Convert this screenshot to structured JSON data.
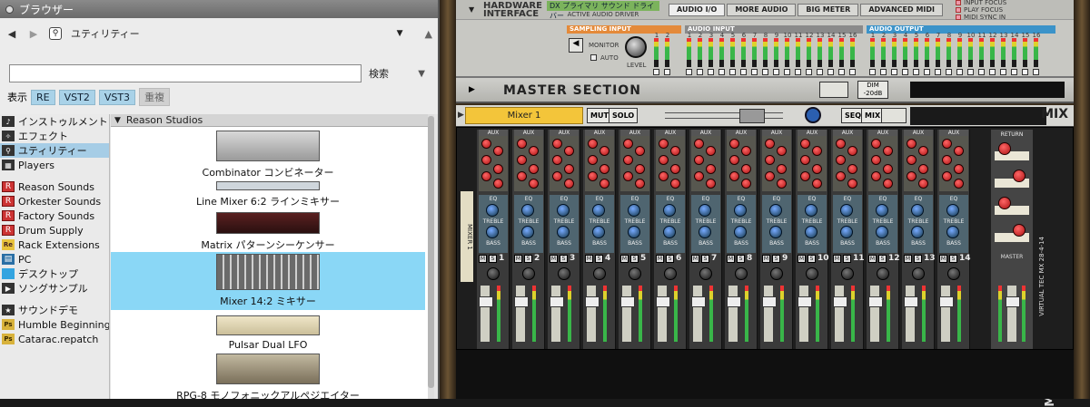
{
  "browser": {
    "title": "ブラウザー",
    "location_label": "ユティリティー",
    "search_placeholder": "",
    "search_button": "検索",
    "filter_label": "表示",
    "filters": [
      {
        "label": "RE",
        "on": true
      },
      {
        "label": "VST2",
        "on": true
      },
      {
        "label": "VST3",
        "on": true
      },
      {
        "label": "重複",
        "on": false
      }
    ],
    "left_items": [
      {
        "label": "インストゥルメント",
        "icon": "instrument-icon",
        "sel": false
      },
      {
        "label": "エフェクト",
        "icon": "effect-icon",
        "sel": false
      },
      {
        "label": "ユティリティー",
        "icon": "utility-icon",
        "sel": true
      },
      {
        "label": "Players",
        "icon": "players-icon",
        "sel": false
      },
      {
        "sep": true
      },
      {
        "label": "Reason Sounds",
        "icon": "reason-icon",
        "sel": false
      },
      {
        "label": "Orkester Sounds",
        "icon": "reason-icon",
        "sel": false
      },
      {
        "label": "Factory Sounds",
        "icon": "reason-icon",
        "sel": false
      },
      {
        "label": "Drum Supply",
        "icon": "reason-icon",
        "sel": false
      },
      {
        "label": "Rack Extensions",
        "icon": "rack-extension-icon",
        "sel": false
      },
      {
        "label": "PC",
        "icon": "pc-icon",
        "sel": false
      },
      {
        "label": "デスクトップ",
        "icon": "desktop-icon",
        "sel": false
      },
      {
        "label": "ソングサンプル",
        "icon": "song-samples-icon",
        "sel": false
      },
      {
        "sep": true
      },
      {
        "label": "サウンドデモ",
        "icon": "star-icon",
        "sel": false
      },
      {
        "label": "Humble Beginnings...",
        "icon": "patch-icon",
        "sel": false
      },
      {
        "label": "Catarac.repatch",
        "icon": "patch-icon",
        "sel": false
      }
    ],
    "folder_header": "Reason Studios",
    "devices": [
      {
        "label": "Combinator コンビネーター",
        "sel": false
      },
      {
        "label": "Line Mixer 6:2 ラインミキサー",
        "sel": false
      },
      {
        "label": "Matrix パターンシーケンサー",
        "sel": false
      },
      {
        "label": "Mixer 14:2 ミキサー",
        "sel": true
      },
      {
        "label": "Pulsar Dual LFO",
        "sel": false
      },
      {
        "label": "RPG-8 モノフォニックアルペジエイター",
        "sel": false
      }
    ]
  },
  "hardware": {
    "title_line1": "HARDWARE",
    "title_line2": "INTERFACE",
    "driver_lcd": "DX  プライマリ サウンド ドライバー",
    "driver_label": "ACTIVE AUDIO DRIVER",
    "tabs": [
      "AUDIO I/O",
      "MORE AUDIO",
      "BIG METER",
      "ADVANCED MIDI"
    ],
    "flags": [
      "INPUT FOCUS",
      "PLAY FOCUS",
      "MIDI SYNC IN"
    ],
    "sampling_input": "SAMPLING INPUT",
    "monitor": "MONITOR",
    "auto": "AUTO",
    "level": "LEVEL",
    "audio_input": "AUDIO INPUT",
    "audio_output": "AUDIO OUTPUT",
    "channels": [
      "1",
      "2",
      "3",
      "4",
      "5",
      "6",
      "7",
      "8",
      "9",
      "10",
      "11",
      "12",
      "13",
      "14",
      "15",
      "16"
    ]
  },
  "master_section": {
    "title": "MASTER SECTION",
    "dim_label": "DIM -20dB"
  },
  "mixer": {
    "name": "Mixer 1",
    "mute": "MUTE",
    "solo": "SOLO",
    "seq": "SEQ",
    "mix": "MIX",
    "logo": "MIX",
    "side_label": "MIXER 1",
    "aux_label": "AUX",
    "eq_label": "EQ",
    "treble_label": "TREBLE",
    "bass_label": "BASS",
    "m_label": "M",
    "s_label": "S",
    "return_label": "RETURN",
    "master_label": "MASTER",
    "remix_label": "VIRTUAL TEC MX 28-4-14",
    "channels": [
      "1",
      "2",
      "3",
      "4",
      "5",
      "6",
      "7",
      "8",
      "9",
      "10",
      "11",
      "12",
      "13",
      "14"
    ]
  }
}
